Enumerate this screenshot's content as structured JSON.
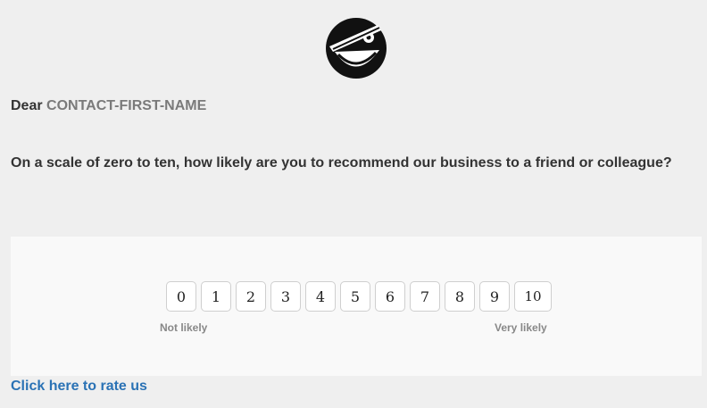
{
  "logo": {
    "icon": "winking-smiley-logo-icon"
  },
  "greeting": {
    "prefix": "Dear",
    "contact_placeholder": "CONTACT-FIRST-NAME"
  },
  "question": {
    "text": "On a scale of zero to ten, how likely are you to recommend our business to a friend or colleague?"
  },
  "rating_scale": {
    "options": [
      "0",
      "1",
      "2",
      "3",
      "4",
      "5",
      "6",
      "7",
      "8",
      "9",
      "10"
    ],
    "low_label": "Not likely",
    "high_label": "Very likely"
  },
  "cta": {
    "label": "Click here to rate us"
  },
  "colors": {
    "background": "#efefef",
    "panel": "#f9f9f9",
    "link": "#2a72b5",
    "text": "#333333",
    "muted": "#7a7a7a"
  }
}
